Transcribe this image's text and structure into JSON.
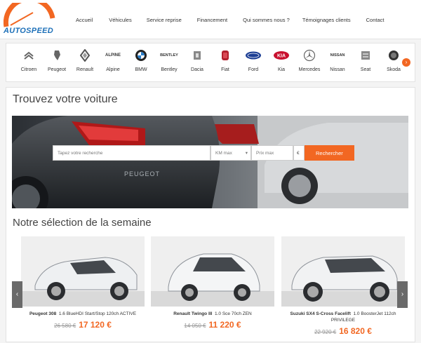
{
  "brand": {
    "logo_text": "AUTOSPEED"
  },
  "nav": [
    "Accueil",
    "Véhicules",
    "Service reprise",
    "Financement",
    "Qui sommes nous ?",
    "Témoignages clients",
    "Contact"
  ],
  "brands": [
    "Citroen",
    "Peugeot",
    "Renault",
    "Alpine",
    "BMW",
    "Bentley",
    "Dacia",
    "Fiat",
    "Ford",
    "Kia",
    "Mercedes",
    "Nissan",
    "Seat",
    "Skoda"
  ],
  "brand_logo_words": {
    "alpine": "ALPINE",
    "bentley": "BENTLEY",
    "kia": "KIA",
    "nissan": "NISSAN"
  },
  "search": {
    "title": "Trouvez votre voiture",
    "query_placeholder": "Tapez votre recherche",
    "km_placeholder": "KM max",
    "price_placeholder": "Prix max",
    "currency": "€",
    "button": "Rechercher",
    "hero_plate_text": "PEUGEOT"
  },
  "selection": {
    "title": "Notre sélection de la semaine",
    "cars": [
      {
        "model": "Peugeot 308",
        "desc": "1.6 BlueHDI Start/Stop 120ch ACTIVE",
        "old_price": "26 580 €",
        "price": "17 120 €"
      },
      {
        "model": "Renault Twingo III",
        "desc": "1.0 Sce 70ch ZEN",
        "old_price": "14 050 €",
        "price": "11 220 €"
      },
      {
        "model": "Suzuki SX4 S-Cross Facelift",
        "desc": "1.0 BoosterJet 112ch PRIVILEGE",
        "old_price": "22 920 €",
        "price": "16 820 €"
      }
    ]
  },
  "colors": {
    "accent": "#f26722",
    "brand_blue": "#1d70b8"
  },
  "icons": {
    "brand_next": "chevron-right-icon",
    "carousel_prev": "chevron-left-icon",
    "carousel_next": "chevron-right-icon"
  }
}
